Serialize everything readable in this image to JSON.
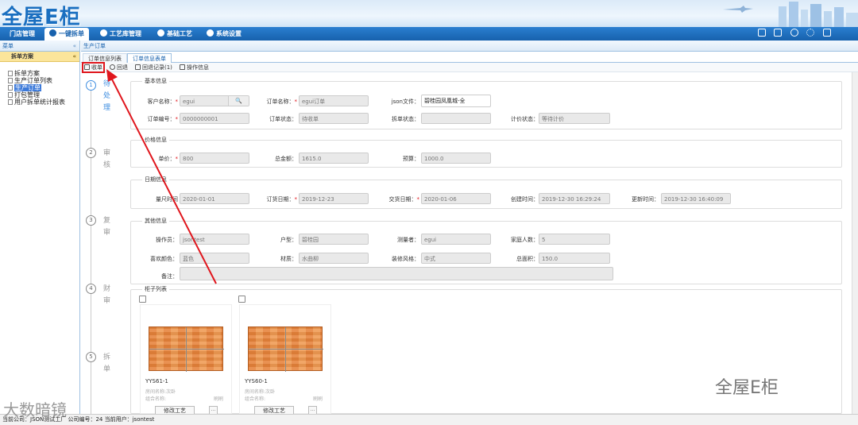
{
  "header": {
    "logo_text": "全屋E柜"
  },
  "nav": {
    "tabs": [
      "门店管理",
      "一键拆单",
      "工艺库管理",
      "基础工艺",
      "系统设置"
    ],
    "active": 1,
    "right_icons": [
      "monitor-icon",
      "calendar-icon",
      "user-icon",
      "gear-icon",
      "logout-icon"
    ]
  },
  "sidebar": {
    "head": "菜单",
    "collapse": "«",
    "section": "拆单方案",
    "section_collapse": "«",
    "items": [
      "拆单方案",
      "生产订单列表",
      "生产订单",
      "打包管理",
      "用户拆单统计报表"
    ],
    "selected": 2
  },
  "main": {
    "breadcrumb": "生产订单",
    "tabs": [
      "订单信息列表",
      "订单信息表单"
    ],
    "active_tab": 1,
    "toolbar": [
      "收单",
      "回退",
      "回退记录(1)",
      "操作信息"
    ]
  },
  "steps": [
    {
      "num": "1",
      "label": "待处理"
    },
    {
      "num": "2",
      "label": "审核"
    },
    {
      "num": "3",
      "label": "复审"
    },
    {
      "num": "4",
      "label": "财审"
    },
    {
      "num": "5",
      "label": "拆单"
    }
  ],
  "basic": {
    "legend": "基本信息",
    "customer_label": "客户名称：",
    "customer_value": "egui",
    "customer_search": "🔍",
    "order_name_label": "订单名称：",
    "order_name_value": "egui订单",
    "json_label": "json文件：",
    "json_value": "碧桂园凤凰城-全",
    "order_no_label": "订单编号：",
    "order_no_value": "0000000001",
    "order_status_label": "订单状态：",
    "order_status_value": "待收单",
    "split_status_label": "拆单状态：",
    "split_status_value": "",
    "price_status_label": "计价状态：",
    "price_status_value": "等待计价"
  },
  "price": {
    "legend": "价格信息",
    "unit_label": "单价：",
    "unit_value": "800",
    "total_label": "总金额：",
    "total_value": "1615.0",
    "budget_label": "预算：",
    "budget_value": "1000.0"
  },
  "dates": {
    "legend": "日期信息",
    "measure_label": "量尺时间",
    "measure_value": "2020-01-01",
    "order_date_label": "订货日期：",
    "order_date_value": "2019-12-23",
    "delivery_label": "交货日期：",
    "delivery_value": "2020-01-06",
    "created_label": "创建时间：",
    "created_value": "2019-12-30 16:29:24",
    "updated_label": "更新时间：",
    "updated_value": "2019-12-30 16:40:09"
  },
  "other": {
    "legend": "其他信息",
    "operator_label": "操作员：",
    "operator_value": "jsontest",
    "house_label": "户型：",
    "house_value": "碧桂园",
    "surveyor_label": "测量者：",
    "surveyor_value": "egui",
    "family_label": "家庭人数：",
    "family_value": "5",
    "color_label": "喜欢颜色：",
    "color_value": "蓝色",
    "material_label": "材质：",
    "material_value": "水曲柳",
    "style_label": "装修风格：",
    "style_value": "中式",
    "area_label": "总面积：",
    "area_value": "150.0",
    "remark_label": "备注：",
    "remark_value": ""
  },
  "cabinets": {
    "legend": "柜子列表",
    "items": [
      {
        "code": "YYS61-1",
        "meta1": "房间名称:次卧",
        "meta2": "组合名称:",
        "meta3": "刷刷",
        "btn": "修改工艺",
        "btn2": "..."
      },
      {
        "code": "YYS60-1",
        "meta1": "房间名称:次卧",
        "meta2": "组合名称:",
        "meta3": "刷刷",
        "btn": "修改工艺",
        "btn2": "..."
      }
    ]
  },
  "statusbar": "当前公司：JSON测试工厂   公司编号：24   当前用户：jsontest",
  "watermarks": {
    "right": "全屋E柜",
    "left": "大数暗镜"
  },
  "colors": {
    "nav": "#1761ad",
    "highlight": "#e0161d",
    "selected": "#3d7ad9"
  }
}
